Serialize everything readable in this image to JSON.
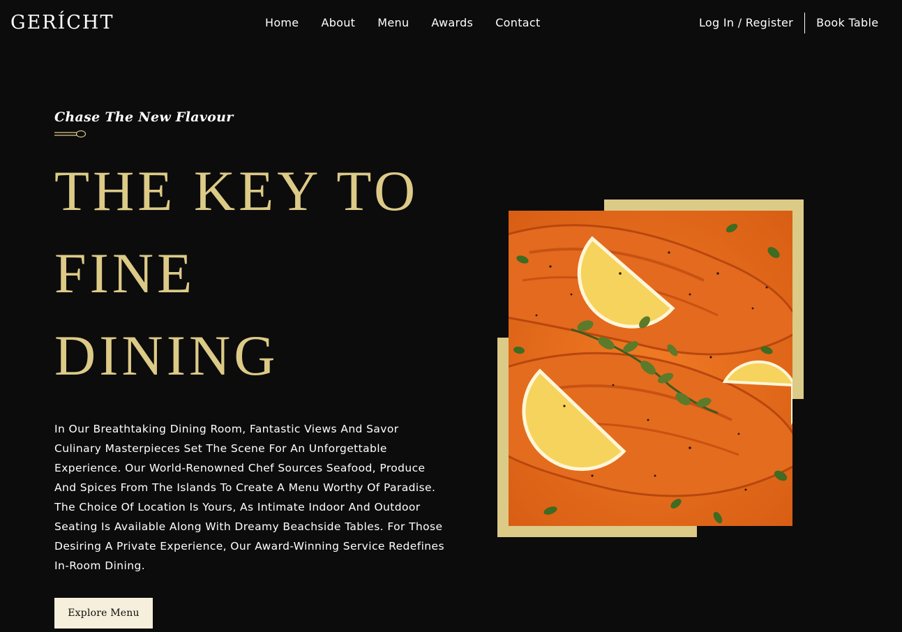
{
  "navbar": {
    "logo": "GERÍCHT",
    "links": [
      "Home",
      "About",
      "Menu",
      "Awards",
      "Contact"
    ],
    "login": "Log In / Register",
    "book": "Book Table"
  },
  "hero": {
    "subtitle": "Chase The New Flavour",
    "headline": [
      "THE KEY TO",
      "FINE",
      "DINING"
    ],
    "description": "In Our Breathtaking Dining Room, Fantastic Views And Savor Culinary Masterpieces Set The Scene For An Unforgettable Experience. Our World-Renowned Chef Sources Seafood, Produce And Spices From The Islands To Create A Menu Worthy Of Paradise. The Choice Of Location Is Yours, As Intimate Indoor And Outdoor Seating Is Available Along With Dreamy Beachside Tables. For Those Desiring A Private Experience, Our Award-Winning Service Redefines In-Room Dining.",
    "button": "Explore Menu"
  },
  "colors": {
    "background": "#0C0C0C",
    "gold": "#DCCA87",
    "button_bg": "#F5EFDB",
    "text": "#FFFFFF"
  },
  "icons": {
    "divider": "spoon-icon",
    "image": "salmon-dish-image"
  }
}
